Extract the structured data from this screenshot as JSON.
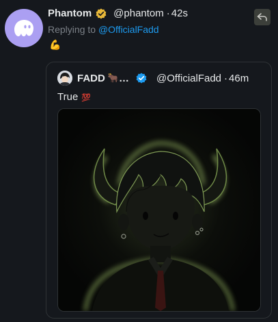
{
  "tweet": {
    "author_name": "Phantom",
    "handle": "@phantom",
    "separator": "·",
    "time": "42s",
    "replying_prefix": "Replying to ",
    "replying_mention": "@OfficialFadd",
    "body_emoji": "💪"
  },
  "quoted": {
    "author_name": "FADD",
    "name_emoji": "🐂",
    "ellipsis": "…",
    "handle": "@OfficialFadd",
    "separator": "·",
    "time": "46m",
    "text": "True",
    "text_emoji": "💯"
  },
  "colors": {
    "background": "#15181d",
    "accent": "#1d9bf0",
    "gold_badge": "#e8b839",
    "avatar_bg": "#ab9ff2",
    "image_glow": "#a3c46a"
  },
  "icons": {
    "phantom_avatar": "ghost-icon",
    "verified_gold": "gold-verified-badge-icon",
    "verified_blue": "blue-verified-badge-icon",
    "reply": "reply-arrow-icon"
  }
}
